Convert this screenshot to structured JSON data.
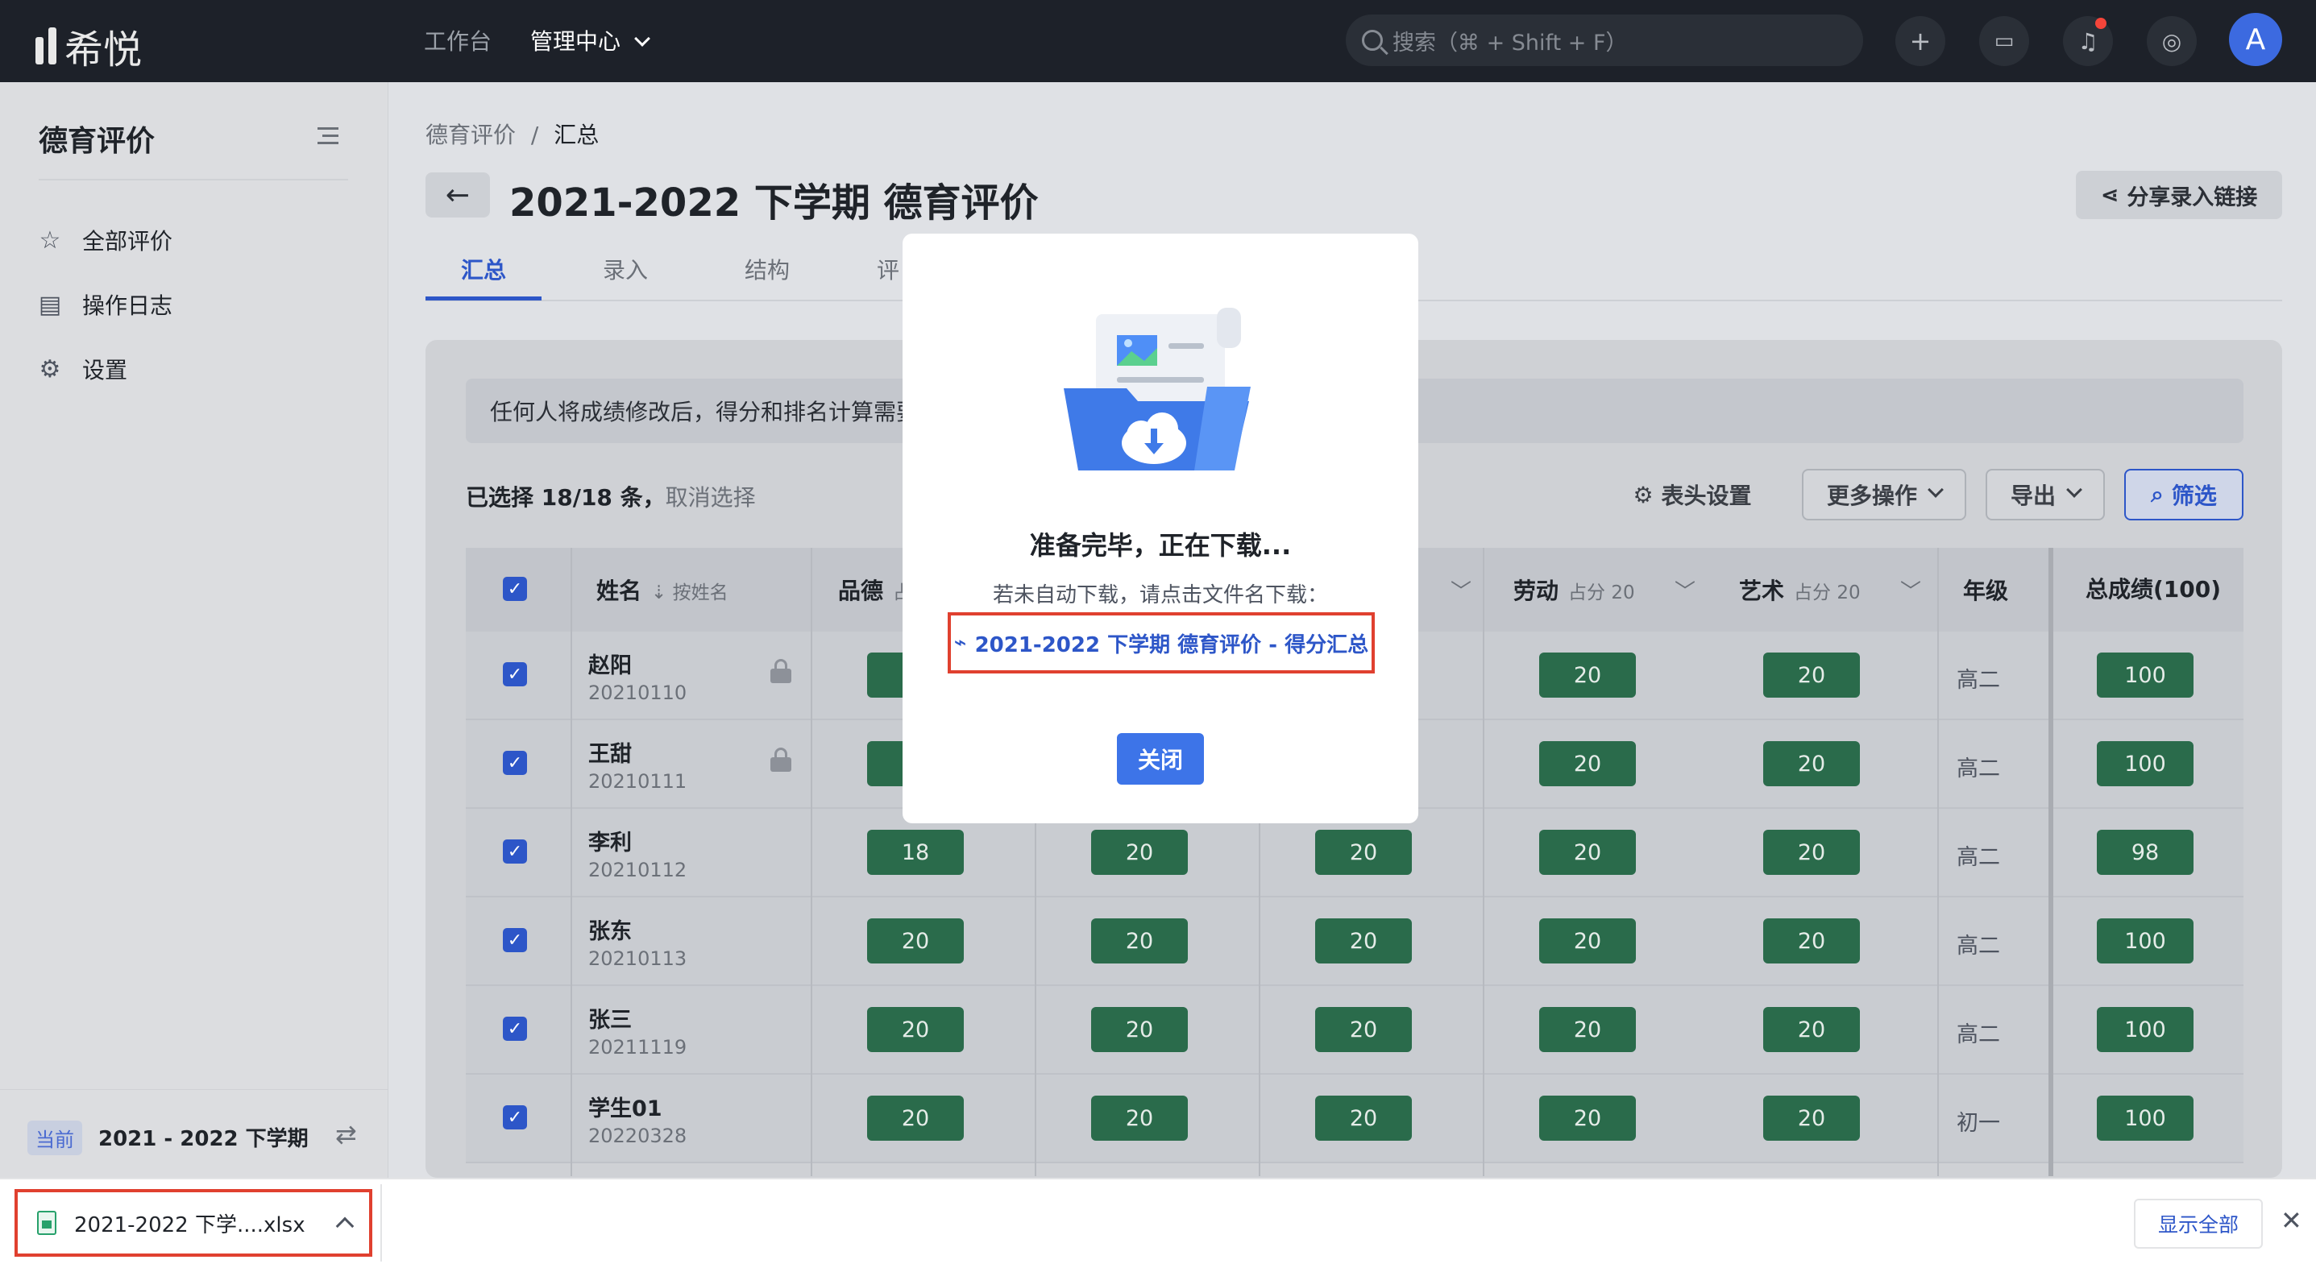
{
  "app": {
    "logo_text": "希悦"
  },
  "topnav": {
    "items": [
      "工作台",
      "管理中心"
    ],
    "search_placeholder": "搜索（⌘ + Shift + F）",
    "avatar_letter": "A"
  },
  "sidebar": {
    "title": "德育评价",
    "items": [
      {
        "label": "全部评价",
        "icon": "star-icon"
      },
      {
        "label": "操作日志",
        "icon": "log-icon"
      },
      {
        "label": "设置",
        "icon": "gear-icon"
      }
    ],
    "current_badge": "当前",
    "current_term": "2021 - 2022 下学期"
  },
  "breadcrumb": [
    "德育评价",
    "/",
    "汇总"
  ],
  "page": {
    "title": "2021-2022 下学期 德育评价",
    "share_label": "分享录入链接"
  },
  "tabs": [
    "汇总",
    "录入",
    "结构",
    "评"
  ],
  "notice": "任何人将成绩修改后，得分和排名计算需要",
  "toolbar": {
    "selected": "已选择 18/18 条，",
    "cancel": "取消选择",
    "header_settings": "表头设置",
    "more_actions": "更多操作",
    "export": "导出",
    "filter": "筛选"
  },
  "table": {
    "headers": {
      "name": "姓名",
      "name_sort": "按姓名",
      "pinde": "品德",
      "pinde_sub": "占",
      "labor": "劳动",
      "labor_sub": "占分 20",
      "art": "艺术",
      "art_sub": "占分 20",
      "grade": "年级",
      "total": "总成绩(100)"
    },
    "rows": [
      {
        "name": "赵阳",
        "id": "20210110",
        "scores": [
          "",
          "",
          "",
          "20",
          "20"
        ],
        "grade": "高二",
        "total": "100"
      },
      {
        "name": "王甜",
        "id": "20210111",
        "scores": [
          "",
          "",
          "",
          "20",
          "20"
        ],
        "grade": "高二",
        "total": "100"
      },
      {
        "name": "李利",
        "id": "20210112",
        "scores": [
          "18",
          "20",
          "20",
          "20",
          "20"
        ],
        "grade": "高二",
        "total": "98"
      },
      {
        "name": "张东",
        "id": "20210113",
        "scores": [
          "20",
          "20",
          "20",
          "20",
          "20"
        ],
        "grade": "高二",
        "total": "100"
      },
      {
        "name": "张三",
        "id": "20211119",
        "scores": [
          "20",
          "20",
          "20",
          "20",
          "20"
        ],
        "grade": "高二",
        "total": "100"
      },
      {
        "name": "学生01",
        "id": "20220328",
        "scores": [
          "20",
          "20",
          "20",
          "20",
          "20"
        ],
        "grade": "初一",
        "total": "100"
      }
    ]
  },
  "modal": {
    "title": "准备完毕，正在下载...",
    "subtitle": "若未自动下载，请点击文件名下载：",
    "file_link": "2021-2022 下学期 德育评价 - 得分汇总",
    "close_label": "关闭"
  },
  "download_bar": {
    "file_name": "2021-2022 下学....xlsx",
    "show_all": "显示全部"
  },
  "colors": {
    "accent": "#2d56c8",
    "score_bg": "#2a6b4b",
    "highlight": "#e0402f"
  }
}
